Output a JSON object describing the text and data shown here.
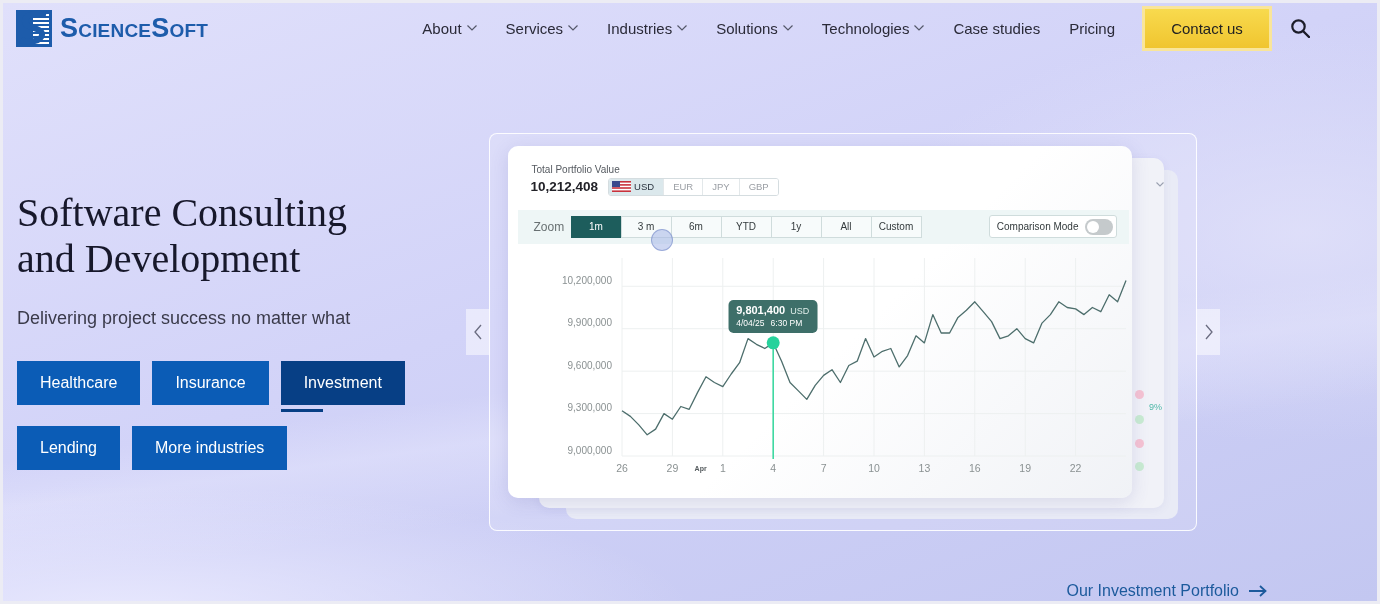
{
  "header": {
    "logo": "ScienceSoft",
    "nav": [
      {
        "label": "About",
        "has_menu": true
      },
      {
        "label": "Services",
        "has_menu": true
      },
      {
        "label": "Industries",
        "has_menu": true
      },
      {
        "label": "Solutions",
        "has_menu": true
      },
      {
        "label": "Technologies",
        "has_menu": true
      },
      {
        "label": "Case studies",
        "has_menu": false
      },
      {
        "label": "Pricing",
        "has_menu": false
      }
    ],
    "contact_button": "Contact us"
  },
  "hero": {
    "title": "Software Consulting\nand Development",
    "subtitle": "Delivering project success no matter what",
    "industries": [
      {
        "label": "Healthcare",
        "selected": false
      },
      {
        "label": "Insurance",
        "selected": false
      },
      {
        "label": "Investment",
        "selected": true
      },
      {
        "label": "Lending",
        "selected": false
      },
      {
        "label": "More industries",
        "selected": false
      }
    ]
  },
  "showcase": {
    "card": {
      "caption": "Total Portfolio Value",
      "total": "10,212,408",
      "currencies": [
        {
          "label": "USD",
          "selected": true
        },
        {
          "label": "EUR",
          "selected": false
        },
        {
          "label": "JPY",
          "selected": false
        },
        {
          "label": "GBP",
          "selected": false
        }
      ],
      "zoom_label": "Zoom",
      "ranges": [
        {
          "label": "1m",
          "selected": true
        },
        {
          "label": "3 m",
          "selected": false
        },
        {
          "label": "6m",
          "selected": false
        },
        {
          "label": "YTD",
          "selected": false
        },
        {
          "label": "1y",
          "selected": false
        },
        {
          "label": "All",
          "selected": false
        },
        {
          "label": "Custom",
          "selected": false
        }
      ],
      "comparison": {
        "label": "Comparison Mode",
        "on": false
      },
      "chart_data": {
        "type": "line",
        "grid": true,
        "categories": [
          "26",
          null,
          null,
          null,
          null,
          null,
          "29",
          null,
          null,
          null,
          null,
          null,
          "1",
          null,
          null,
          null,
          null,
          null,
          "4",
          null,
          null,
          null,
          null,
          null,
          "7",
          null,
          null,
          null,
          null,
          null,
          "10",
          null,
          null,
          null,
          null,
          null,
          "13",
          null,
          null,
          null,
          null,
          null,
          "16",
          null,
          null,
          null,
          null,
          null,
          "19",
          null,
          null,
          null,
          null,
          null,
          "22",
          null,
          null,
          null,
          null,
          null,
          null
        ],
        "values": [
          9320000,
          9280000,
          9220000,
          9150000,
          9190000,
          9300000,
          9260000,
          9350000,
          9330000,
          9450000,
          9560000,
          9520000,
          9490000,
          9580000,
          9660000,
          9830000,
          9790000,
          9760000,
          9800000,
          9670000,
          9520000,
          9460000,
          9400000,
          9500000,
          9570000,
          9610000,
          9520000,
          9640000,
          9670000,
          9830000,
          9700000,
          9740000,
          9760000,
          9630000,
          9710000,
          9850000,
          9800000,
          10000000,
          9870000,
          9870000,
          9980000,
          10030000,
          10090000,
          10020000,
          9950000,
          9830000,
          9850000,
          9900000,
          9830000,
          9800000,
          9940000,
          10000000,
          10090000,
          10050000,
          10040000,
          10000000,
          10050000,
          10020000,
          10140000,
          10090000,
          10240000
        ],
        "ylim": [
          9000000,
          10400000
        ],
        "yticks": [
          {
            "value": 9000000,
            "label": "9,000,000"
          },
          {
            "value": 9300000,
            "label": "9,300,000"
          },
          {
            "value": 9600000,
            "label": "9,600,000"
          },
          {
            "value": 9900000,
            "label": "9,900,000"
          },
          {
            "value": 10200000,
            "label": "10,200,000"
          }
        ],
        "annotations": [
          "Apr",
          {
            "x": "4",
            "y": 9800000,
            "text": "9,801,400"
          }
        ]
      },
      "tooltip": {
        "unit": "USD",
        "date": "4/04/25",
        "time": "6:30 PM"
      }
    },
    "back_card": {
      "label": "9%",
      "markers": [
        {
          "color": "#f6c3d3"
        },
        {
          "color": "#c9ecd2"
        },
        {
          "color": "#f6c3d3"
        },
        {
          "color": "#c9ecd2"
        }
      ]
    }
  },
  "portfolio_link": "Our Investment Portfolio"
}
